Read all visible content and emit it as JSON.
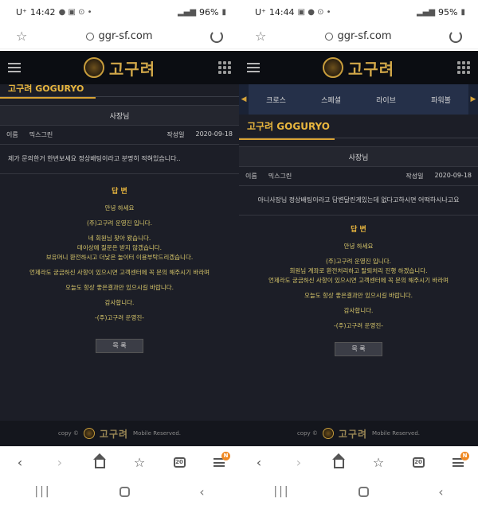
{
  "left": {
    "status": {
      "carrier": "U⁺",
      "time": "14:42",
      "battery": "96%"
    },
    "url": "ggr-sf.com",
    "site": {
      "logo": "고구려",
      "section_title": "고구려 GOGURYO",
      "post_title": "사장님",
      "meta": {
        "name_label": "이름",
        "name_value": "믹스그린",
        "date_label": "작성일",
        "date_value": "2020-09-18"
      },
      "question": "제가 문의한거 한번보세요 정상배팅이라고 분명히 적혀있습니다..",
      "answer_label": "답 변",
      "answer_lines": [
        "안녕 하세요",
        "(주)고구려 운영진 입니다.",
        "네 회원님 찾아 봤습니다.",
        "데이상에 질문은 받지 않겠습니다.",
        "보유머니 환전하시고 더낮은 놀이터 이용부탁드리겠습니다.",
        "언제라도 궁금하신 사항이 있으시면 고객센터에 꼭 문의 해주시기 바라며",
        "오늘도 항상 좋은결과만 있으시길 바랍니다.",
        "감사합니다.",
        "-(주)고구려 운영진-"
      ],
      "list_button": "목 록",
      "footer": {
        "copy": "copy ©",
        "logo": "고구려",
        "reserved": "Mobile Reserved."
      }
    },
    "tabs_count": "20",
    "menu_badge": "N"
  },
  "right": {
    "status": {
      "carrier": "U⁺",
      "time": "14:44",
      "battery": "95%"
    },
    "url": "ggr-sf.com",
    "site": {
      "logo": "고구려",
      "nav_items": [
        "크로스",
        "스페셜",
        "라이브",
        "파워볼"
      ],
      "section_title": "고구려 GOGURYO",
      "post_title": "사장님",
      "meta": {
        "name_label": "이름",
        "name_value": "믹스그린",
        "date_label": "작성일",
        "date_value": "2020-09-18"
      },
      "question": "아니사장님 정상배팅이라고 답변달린게있는데 없다고하시면 어떡하시나고요",
      "answer_label": "답 변",
      "answer_lines": [
        "안녕 하세요",
        "(주)고구려 운영진 입니다.",
        "회원님 계좌로 환전처리하고 탈퇴처리 진행 하겠습니다.",
        "언제라도 궁금하신 사항이 있으시면 고객센터에 꼭 문의 해주시기 바라며",
        "오늘도 항상 좋은결과만 있으시길 바랍니다.",
        "감사합니다.",
        "-(주)고구려 운영진-"
      ],
      "list_button": "목 록",
      "footer": {
        "copy": "copy ©",
        "logo": "고구려",
        "reserved": "Mobile Reserved."
      }
    },
    "tabs_count": "20",
    "menu_badge": "N"
  }
}
